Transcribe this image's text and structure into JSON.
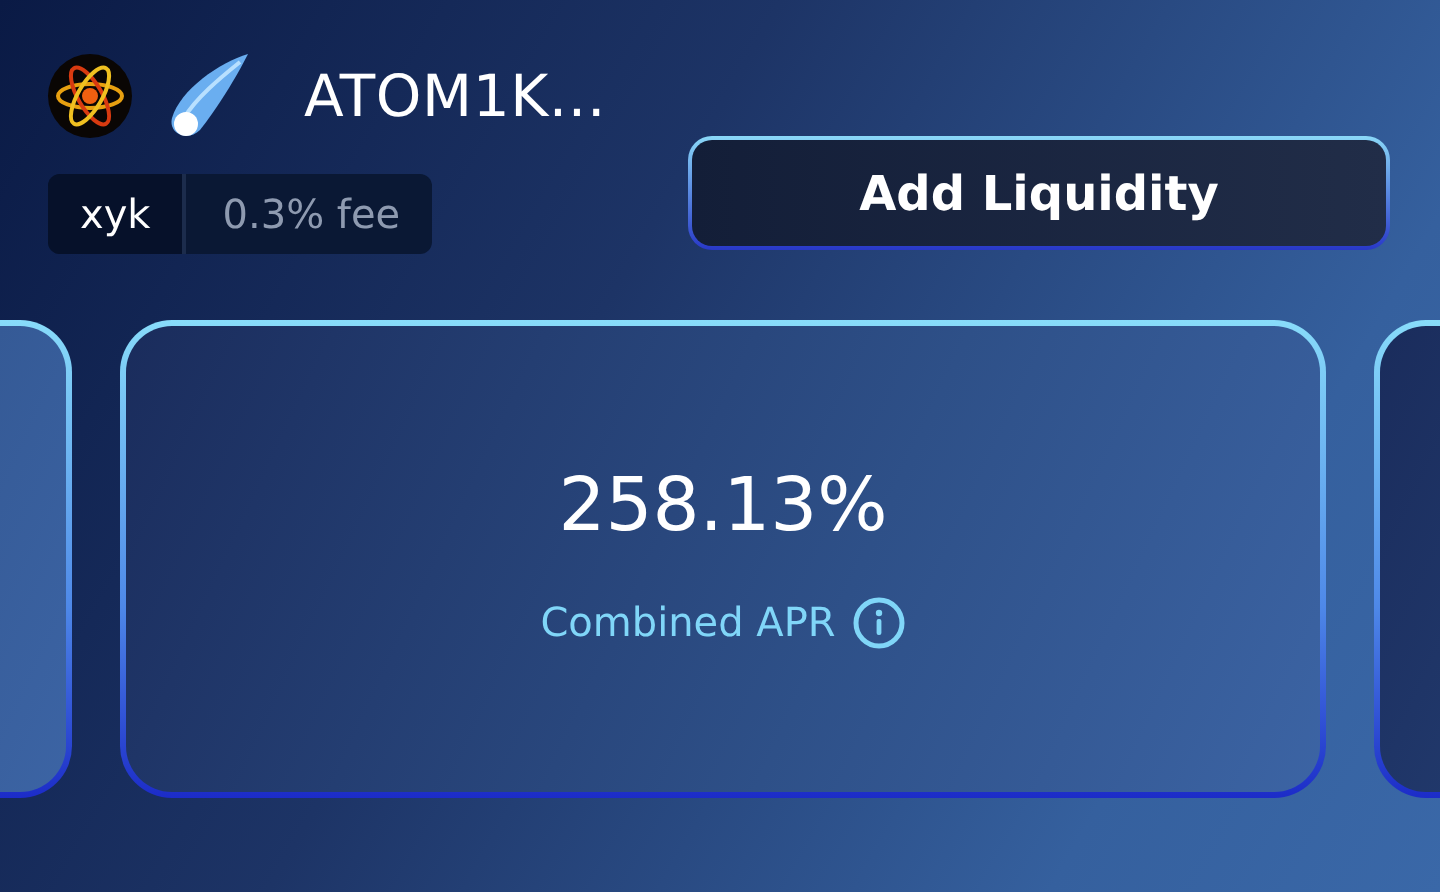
{
  "pool": {
    "title": "ATOM1K...",
    "tags": [
      {
        "label": "xyk",
        "kind": "type"
      },
      {
        "label": "0.3% fee",
        "kind": "fee"
      }
    ]
  },
  "add_button": {
    "label": "Add Liquidity"
  },
  "apr_card": {
    "value": "258.13%",
    "label": "Combined APR"
  }
}
